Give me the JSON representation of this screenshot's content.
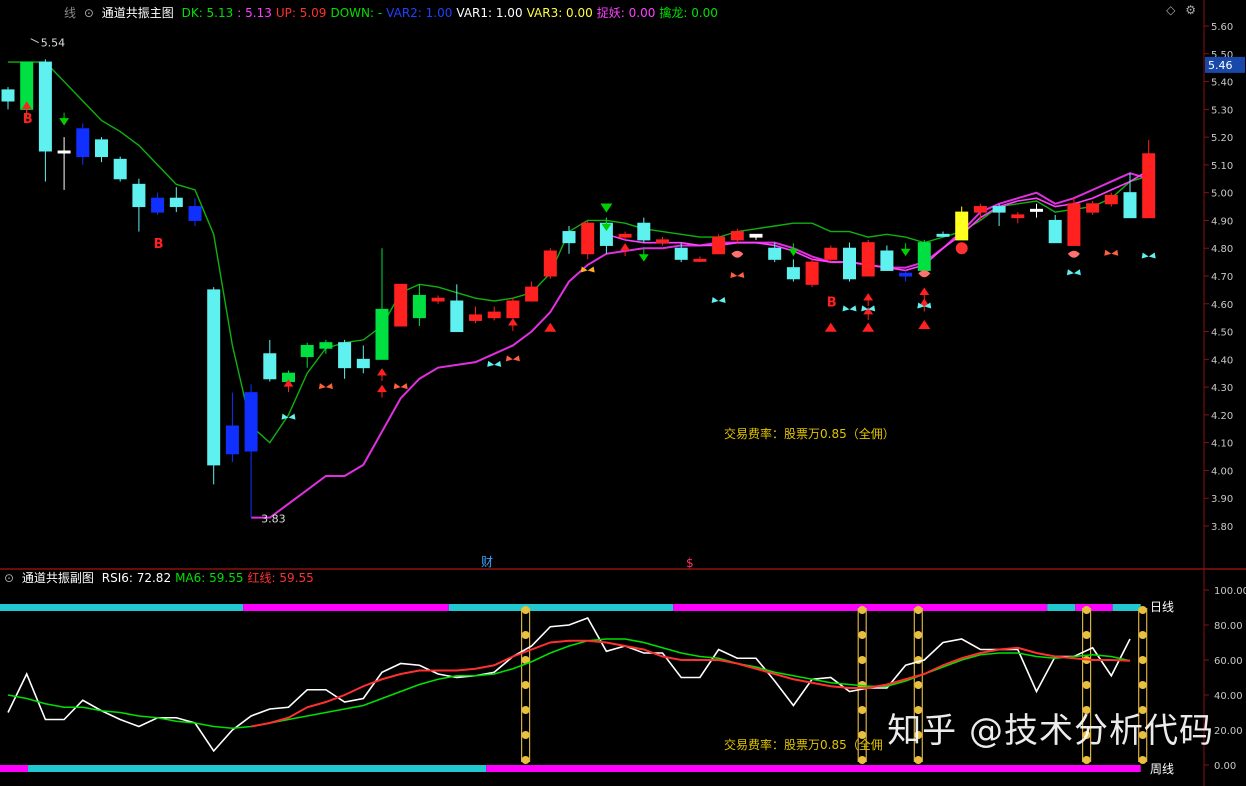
{
  "main_header": {
    "prefix": "线",
    "title": "通道共振主图",
    "items": [
      {
        "label": "DK:",
        "value": "5.13",
        "color": "#00e000"
      },
      {
        "label": ":",
        "value": "5.13",
        "color": "#ff40ff"
      },
      {
        "label": "UP:",
        "value": "5.09",
        "color": "#ff3030"
      },
      {
        "label": "DOWN:",
        "value": "-",
        "color": "#00e000"
      },
      {
        "label": "VAR2:",
        "value": "1.00",
        "color": "#2040ff"
      },
      {
        "label": "VAR1:",
        "value": "1.00",
        "color": "#ffffff"
      },
      {
        "label": "VAR3:",
        "value": "0.00",
        "color": "#ffff40"
      },
      {
        "label": "捉妖:",
        "value": "0.00",
        "color": "#ff40ff"
      },
      {
        "label": "擒龙:",
        "value": "0.00",
        "color": "#00e000"
      }
    ]
  },
  "sub_header": {
    "title": "通道共振副图",
    "items": [
      {
        "label": "RSI6:",
        "value": "72.82",
        "color": "#ffffff"
      },
      {
        "label": "MA6:",
        "value": "59.55",
        "color": "#00e000"
      },
      {
        "label": "红线:",
        "value": "59.55",
        "color": "#ff3030"
      }
    ]
  },
  "notes": {
    "fee_main": "交易费率：股票万0.85（全佣）",
    "fee_sub": "交易费率：股票万0.85（全佣",
    "watermark": "知乎 @技术分析代码",
    "marker_cai": "财",
    "marker_dollar": "$",
    "buy_letter": "B",
    "daily_line": "日线",
    "weekly_line": "周线"
  },
  "chart_data": [
    {
      "type": "candlestick",
      "title": "通道共振主图",
      "ylim": [
        3.75,
        5.65
      ],
      "y_ticks": [
        "5.60",
        "5.50",
        "5.40",
        "5.30",
        "5.20",
        "5.10",
        "5.00",
        "4.90",
        "4.80",
        "4.70",
        "4.60",
        "4.50",
        "4.40",
        "4.30",
        "4.20",
        "4.10",
        "4.00",
        "3.90",
        "3.80"
      ],
      "current_price": "5.46",
      "high_label": "5.54",
      "low_label": "3.83",
      "candles": [
        {
          "o": 5.33,
          "h": 5.38,
          "l": 5.3,
          "c": 5.37,
          "col": "cyan"
        },
        {
          "o": 5.3,
          "h": 5.47,
          "l": 5.27,
          "c": 5.47,
          "col": "green"
        },
        {
          "o": 5.47,
          "h": 5.48,
          "l": 5.04,
          "c": 5.15,
          "col": "cyan"
        },
        {
          "o": 5.15,
          "h": 5.2,
          "l": 5.01,
          "c": 5.15,
          "col": "white"
        },
        {
          "o": 5.23,
          "h": 5.25,
          "l": 5.1,
          "c": 5.13,
          "col": "blue"
        },
        {
          "o": 5.19,
          "h": 5.2,
          "l": 5.11,
          "c": 5.13,
          "col": "cyan"
        },
        {
          "o": 5.12,
          "h": 5.13,
          "l": 5.04,
          "c": 5.05,
          "col": "cyan"
        },
        {
          "o": 5.03,
          "h": 5.05,
          "l": 4.86,
          "c": 4.95,
          "col": "cyan"
        },
        {
          "o": 4.98,
          "h": 5.0,
          "l": 4.92,
          "c": 4.93,
          "col": "blue"
        },
        {
          "o": 4.98,
          "h": 5.02,
          "l": 4.93,
          "c": 4.95,
          "col": "cyan"
        },
        {
          "o": 4.95,
          "h": 4.98,
          "l": 4.88,
          "c": 4.9,
          "col": "blue"
        },
        {
          "o": 4.65,
          "h": 4.66,
          "l": 3.95,
          "c": 4.02,
          "col": "cyan"
        },
        {
          "o": 4.16,
          "h": 4.28,
          "l": 4.03,
          "c": 4.06,
          "col": "blue"
        },
        {
          "o": 4.28,
          "h": 4.31,
          "l": 3.83,
          "c": 4.07,
          "col": "blue"
        },
        {
          "o": 4.42,
          "h": 4.47,
          "l": 4.32,
          "c": 4.33,
          "col": "cyan"
        },
        {
          "o": 4.32,
          "h": 4.36,
          "l": 4.31,
          "c": 4.35,
          "col": "green"
        },
        {
          "o": 4.41,
          "h": 4.46,
          "l": 4.37,
          "c": 4.45,
          "col": "green"
        },
        {
          "o": 4.44,
          "h": 4.47,
          "l": 4.42,
          "c": 4.46,
          "col": "green"
        },
        {
          "o": 4.46,
          "h": 4.47,
          "l": 4.33,
          "c": 4.37,
          "col": "cyan"
        },
        {
          "o": 4.37,
          "h": 4.45,
          "l": 4.35,
          "c": 4.4,
          "col": "cyan"
        },
        {
          "o": 4.4,
          "h": 4.8,
          "l": 4.4,
          "c": 4.58,
          "col": "green"
        },
        {
          "o": 4.52,
          "h": 4.67,
          "l": 4.52,
          "c": 4.67,
          "col": "red"
        },
        {
          "o": 4.55,
          "h": 4.67,
          "l": 4.52,
          "c": 4.63,
          "col": "green"
        },
        {
          "o": 4.61,
          "h": 4.63,
          "l": 4.6,
          "c": 4.62,
          "col": "red"
        },
        {
          "o": 4.61,
          "h": 4.67,
          "l": 4.5,
          "c": 4.5,
          "col": "cyan"
        },
        {
          "o": 4.54,
          "h": 4.59,
          "l": 4.53,
          "c": 4.56,
          "col": "red"
        },
        {
          "o": 4.55,
          "h": 4.59,
          "l": 4.54,
          "c": 4.57,
          "col": "red"
        },
        {
          "o": 4.55,
          "h": 4.62,
          "l": 4.55,
          "c": 4.61,
          "col": "red"
        },
        {
          "o": 4.61,
          "h": 4.68,
          "l": 4.61,
          "c": 4.66,
          "col": "red"
        },
        {
          "o": 4.7,
          "h": 4.8,
          "l": 4.69,
          "c": 4.79,
          "col": "red"
        },
        {
          "o": 4.86,
          "h": 4.88,
          "l": 4.78,
          "c": 4.82,
          "col": "cyan"
        },
        {
          "o": 4.78,
          "h": 4.9,
          "l": 4.76,
          "c": 4.89,
          "col": "red"
        },
        {
          "o": 4.89,
          "h": 4.91,
          "l": 4.78,
          "c": 4.81,
          "col": "cyan"
        },
        {
          "o": 4.84,
          "h": 4.86,
          "l": 4.83,
          "c": 4.85,
          "col": "red"
        },
        {
          "o": 4.89,
          "h": 4.91,
          "l": 4.82,
          "c": 4.83,
          "col": "cyan"
        },
        {
          "o": 4.82,
          "h": 4.84,
          "l": 4.81,
          "c": 4.83,
          "col": "red"
        },
        {
          "o": 4.8,
          "h": 4.82,
          "l": 4.75,
          "c": 4.76,
          "col": "cyan"
        },
        {
          "o": 4.76,
          "h": 4.77,
          "l": 4.75,
          "c": 4.76,
          "col": "red"
        },
        {
          "o": 4.78,
          "h": 4.85,
          "l": 4.78,
          "c": 4.84,
          "col": "red"
        },
        {
          "o": 4.86,
          "h": 4.87,
          "l": 4.82,
          "c": 4.83,
          "col": "red"
        },
        {
          "o": 4.84,
          "h": 4.85,
          "l": 4.83,
          "c": 4.85,
          "col": "white"
        },
        {
          "o": 4.8,
          "h": 4.82,
          "l": 4.75,
          "c": 4.76,
          "col": "cyan"
        },
        {
          "o": 4.73,
          "h": 4.76,
          "l": 4.68,
          "c": 4.69,
          "col": "cyan"
        },
        {
          "o": 4.67,
          "h": 4.76,
          "l": 4.66,
          "c": 4.75,
          "col": "red"
        },
        {
          "o": 4.76,
          "h": 4.81,
          "l": 4.75,
          "c": 4.8,
          "col": "red"
        },
        {
          "o": 4.8,
          "h": 4.82,
          "l": 4.68,
          "c": 4.69,
          "col": "cyan"
        },
        {
          "o": 4.7,
          "h": 4.83,
          "l": 4.7,
          "c": 4.82,
          "col": "red"
        },
        {
          "o": 4.79,
          "h": 4.81,
          "l": 4.72,
          "c": 4.72,
          "col": "cyan"
        },
        {
          "o": 4.71,
          "h": 4.72,
          "l": 4.68,
          "c": 4.7,
          "col": "blue"
        },
        {
          "o": 4.72,
          "h": 4.83,
          "l": 4.7,
          "c": 4.82,
          "col": "green"
        },
        {
          "o": 4.85,
          "h": 4.86,
          "l": 4.84,
          "c": 4.85,
          "col": "cyan"
        },
        {
          "o": 4.83,
          "h": 4.95,
          "l": 4.83,
          "c": 4.93,
          "col": "yellow"
        },
        {
          "o": 4.93,
          "h": 4.96,
          "l": 4.9,
          "c": 4.95,
          "col": "red"
        },
        {
          "o": 4.95,
          "h": 4.96,
          "l": 4.88,
          "c": 4.93,
          "col": "cyan"
        },
        {
          "o": 4.91,
          "h": 4.93,
          "l": 4.89,
          "c": 4.92,
          "col": "red"
        },
        {
          "o": 4.94,
          "h": 4.96,
          "l": 4.91,
          "c": 4.94,
          "col": "white"
        },
        {
          "o": 4.9,
          "h": 4.92,
          "l": 4.82,
          "c": 4.82,
          "col": "cyan"
        },
        {
          "o": 4.81,
          "h": 4.98,
          "l": 4.81,
          "c": 4.96,
          "col": "red"
        },
        {
          "o": 4.93,
          "h": 4.97,
          "l": 4.92,
          "c": 4.96,
          "col": "red"
        },
        {
          "o": 4.96,
          "h": 5.0,
          "l": 4.95,
          "c": 4.99,
          "col": "red"
        },
        {
          "o": 5.0,
          "h": 5.07,
          "l": 4.92,
          "c": 4.91,
          "col": "cyan"
        },
        {
          "o": 4.91,
          "h": 5.19,
          "l": 4.91,
          "c": 5.14,
          "col": "red"
        }
      ],
      "upper_band": [
        5.47,
        5.47,
        5.47,
        5.4,
        5.33,
        5.26,
        5.22,
        5.17,
        5.1,
        5.03,
        5.01,
        4.85,
        4.45,
        4.16,
        4.1,
        4.2,
        4.35,
        4.44,
        4.46,
        4.47,
        4.52,
        4.64,
        4.67,
        4.66,
        4.64,
        4.62,
        4.61,
        4.62,
        4.64,
        4.71,
        4.86,
        4.9,
        4.9,
        4.89,
        4.87,
        4.86,
        4.85,
        4.84,
        4.84,
        4.86,
        4.87,
        4.88,
        4.89,
        4.89,
        4.86,
        4.86,
        4.84,
        4.85,
        4.84,
        4.82,
        4.84,
        4.86,
        4.9,
        4.95,
        4.96,
        4.97,
        4.93,
        4.94,
        4.95,
        4.98,
        5.04,
        5.06
      ],
      "lower_band": [
        null,
        null,
        null,
        null,
        null,
        null,
        null,
        null,
        null,
        null,
        null,
        null,
        null,
        3.83,
        3.83,
        3.88,
        3.93,
        3.98,
        3.98,
        4.02,
        4.14,
        4.26,
        4.33,
        4.37,
        4.38,
        4.39,
        4.42,
        4.45,
        4.5,
        4.57,
        4.68,
        4.74,
        4.78,
        4.79,
        4.8,
        4.8,
        4.81,
        4.81,
        4.82,
        4.82,
        4.82,
        4.82,
        4.8,
        4.77,
        4.75,
        4.75,
        4.74,
        4.73,
        4.73,
        4.75,
        4.8,
        4.86,
        4.93,
        4.96,
        4.98,
        5.0,
        4.96,
        4.98,
        5.01,
        5.04,
        5.07,
        5.05
      ],
      "mid_line": [
        null,
        null,
        null,
        null,
        null,
        null,
        null,
        null,
        null,
        null,
        null,
        null,
        null,
        null,
        null,
        null,
        null,
        null,
        null,
        null,
        null,
        null,
        null,
        null,
        null,
        null,
        null,
        null,
        null,
        null,
        null,
        null,
        4.85,
        4.83,
        4.82,
        4.82,
        4.82,
        4.81,
        4.81,
        4.82,
        4.82,
        4.81,
        4.79,
        4.76,
        4.75,
        4.75,
        4.74,
        4.73,
        4.72,
        4.74,
        4.8,
        4.85,
        4.91,
        4.95,
        4.97,
        4.98,
        4.95,
        4.96,
        4.98,
        5.01,
        5.04,
        5.08
      ]
    },
    {
      "type": "line",
      "title": "通道共振副图",
      "ylim": [
        0,
        100
      ],
      "y_ticks": [
        "100.00",
        "80.00",
        "60.00",
        "40.00",
        "20.00",
        "0.00"
      ],
      "series": [
        {
          "name": "RSI6",
          "color": "#ffffff",
          "values": [
            30,
            52,
            26,
            26,
            37,
            31,
            26,
            22,
            27,
            27,
            24,
            8,
            20,
            28,
            32,
            33,
            43,
            43,
            36,
            38,
            53,
            58,
            57,
            52,
            50,
            51,
            53,
            62,
            68,
            79,
            80,
            84,
            65,
            68,
            64,
            64,
            50,
            50,
            66,
            61,
            61,
            48,
            34,
            49,
            50,
            42,
            44,
            44,
            57,
            60,
            70,
            72,
            66,
            66,
            66,
            42,
            62,
            62,
            67,
            51,
            72
          ]
        },
        {
          "name": "MA6",
          "color": "#00e000",
          "values": [
            40,
            38,
            35,
            33,
            33,
            31,
            30,
            28,
            27,
            25,
            24,
            22,
            21,
            22,
            24,
            26,
            28,
            30,
            32,
            34,
            38,
            42,
            46,
            49,
            51,
            51,
            52,
            55,
            59,
            64,
            68,
            71,
            72,
            72,
            70,
            67,
            64,
            62,
            61,
            58,
            56,
            53,
            51,
            49,
            47,
            46,
            45,
            45,
            48,
            52,
            56,
            60,
            63,
            64,
            64,
            62,
            61,
            62,
            63,
            62,
            59.55
          ]
        },
        {
          "name": "红线",
          "color": "#ff3030",
          "values": [
            null,
            null,
            null,
            null,
            null,
            null,
            null,
            null,
            null,
            null,
            null,
            null,
            null,
            22,
            24,
            27,
            33,
            36,
            40,
            45,
            49,
            52,
            54,
            54,
            54,
            55,
            57,
            62,
            66,
            70,
            71,
            71,
            70,
            68,
            66,
            62,
            60,
            60,
            60,
            58,
            55,
            52,
            49,
            47,
            45,
            44,
            44,
            46,
            49,
            52,
            57,
            61,
            64,
            66,
            67,
            64,
            62,
            61,
            60,
            60,
            59.55
          ]
        }
      ],
      "daily_bar": [
        {
          "from": 0,
          "to": 13,
          "color": "#20c8d0"
        },
        {
          "from": 13,
          "to": 24,
          "color": "#ff00ff"
        },
        {
          "from": 24,
          "to": 36,
          "color": "#20c8d0"
        },
        {
          "from": 36,
          "to": 56,
          "color": "#ff00ff"
        },
        {
          "from": 56,
          "to": 57.5,
          "color": "#20c8d0"
        },
        {
          "from": 57.5,
          "to": 59.5,
          "color": "#ff00ff"
        },
        {
          "from": 59.5,
          "to": 61,
          "color": "#20c8d0"
        }
      ],
      "weekly_bar": [
        {
          "from": 0,
          "to": 1.5,
          "color": "#ff00ff"
        },
        {
          "from": 1.5,
          "to": 26,
          "color": "#20c8d0"
        },
        {
          "from": 26,
          "to": 61,
          "color": "#ff00ff"
        }
      ],
      "signal_columns": [
        28,
        46,
        49,
        58,
        61
      ]
    }
  ]
}
